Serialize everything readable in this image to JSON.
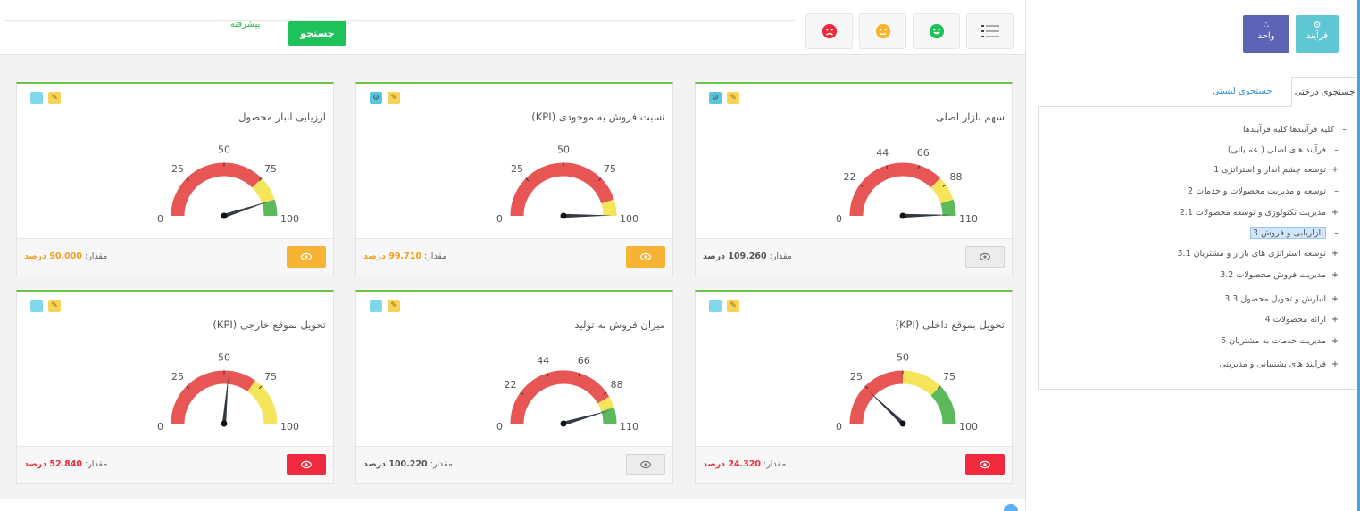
{
  "toolbar": {
    "advanced_label": "پیشرفته",
    "search_label": "جستجو"
  },
  "sidebar": {
    "process_label": "فرآیند",
    "unit_label": "واحد",
    "tab_tree": "جستجوی درختی",
    "tab_list": "جستجوی لیستی",
    "tree": [
      {
        "sign": "–",
        "label": "کلیه فرآیندها کلیه فرآیندها"
      },
      {
        "sign": "–",
        "label": "فرآیند های اصلی ( عملیاتی)"
      },
      {
        "sign": "+",
        "label": "توسعه چشم انداز و استراتژی 1"
      },
      {
        "sign": "–",
        "label": "توسعه و مدیریت محصولات و خدمات 2"
      },
      {
        "sign": "+",
        "label": "مدیریت تکنولوژی و توسعه محصولات 2.1"
      },
      {
        "sign": "–",
        "label": "بازاریابی و فروش 3"
      },
      {
        "sign": "+",
        "label": "توسعه استراتژی های بازار و مشتریان 3.1"
      },
      {
        "sign": "+",
        "label": "مدیریت فروش محصولات 3.2"
      },
      {
        "sign": "+",
        "label": "انبارش و تحویل محصول 3.3"
      },
      {
        "sign": "+",
        "label": "ارائه محصولات 4"
      },
      {
        "sign": "+",
        "label": "مدیریت خدمات به مشتریان 5"
      },
      {
        "sign": "+",
        "label": "فرآیند های پشتیبانی و مدیریتی"
      }
    ]
  },
  "value_prefix": "مقدار:",
  "cards": [
    {
      "title": "ارزیابی انبار محصول",
      "value": "90.000 درصد",
      "ticks": [
        "0",
        "25",
        "50",
        "75",
        "100"
      ],
      "min": 0,
      "max": 100,
      "needle": 90,
      "red_end": 0.75,
      "yellow_end": 0.9,
      "status": "orange"
    },
    {
      "title": "نسبت فروش به موجودی (KPI)",
      "value": "99.710 درصد",
      "ticks": [
        "0",
        "25",
        "50",
        "75",
        "100"
      ],
      "min": 0,
      "max": 100,
      "needle": 99.71,
      "red_end": 0.9,
      "yellow_end": 1.0,
      "status": "orange"
    },
    {
      "title": "سهم بازار اصلی",
      "value": "109.260 درصد",
      "ticks": [
        "0",
        "22",
        "44",
        "66",
        "88",
        "110"
      ],
      "min": 0,
      "max": 110,
      "needle": 109.26,
      "red_end": 0.75,
      "yellow_end": 0.9,
      "status": "grey"
    },
    {
      "title": "تحویل بموقع خارجی (KPI)",
      "value": "52.840 درصد",
      "ticks": [
        "0",
        "25",
        "50",
        "75",
        "100"
      ],
      "min": 0,
      "max": 100,
      "needle": 52.84,
      "red_end": 0.7,
      "yellow_end": 1.0,
      "status": "red"
    },
    {
      "title": "میزان فروش به تولید",
      "value": "100.220 درصد",
      "ticks": [
        "0",
        "22",
        "44",
        "66",
        "88",
        "110"
      ],
      "min": 0,
      "max": 110,
      "needle": 100.22,
      "red_end": 0.83,
      "yellow_end": 0.9,
      "status": "grey"
    },
    {
      "title": "تحویل بموقع داخلی (KPI)",
      "value": "24.320 درصد",
      "ticks": [
        "0",
        "25",
        "50",
        "75",
        "100"
      ],
      "min": 0,
      "max": 100,
      "needle": 24.32,
      "red_end": 0.5,
      "yellow_end": 0.75,
      "status": "red"
    }
  ],
  "colors": {
    "red": "#e85555",
    "yellow": "#f5e55a",
    "green": "#5cba5c",
    "needle": "#333a44"
  }
}
